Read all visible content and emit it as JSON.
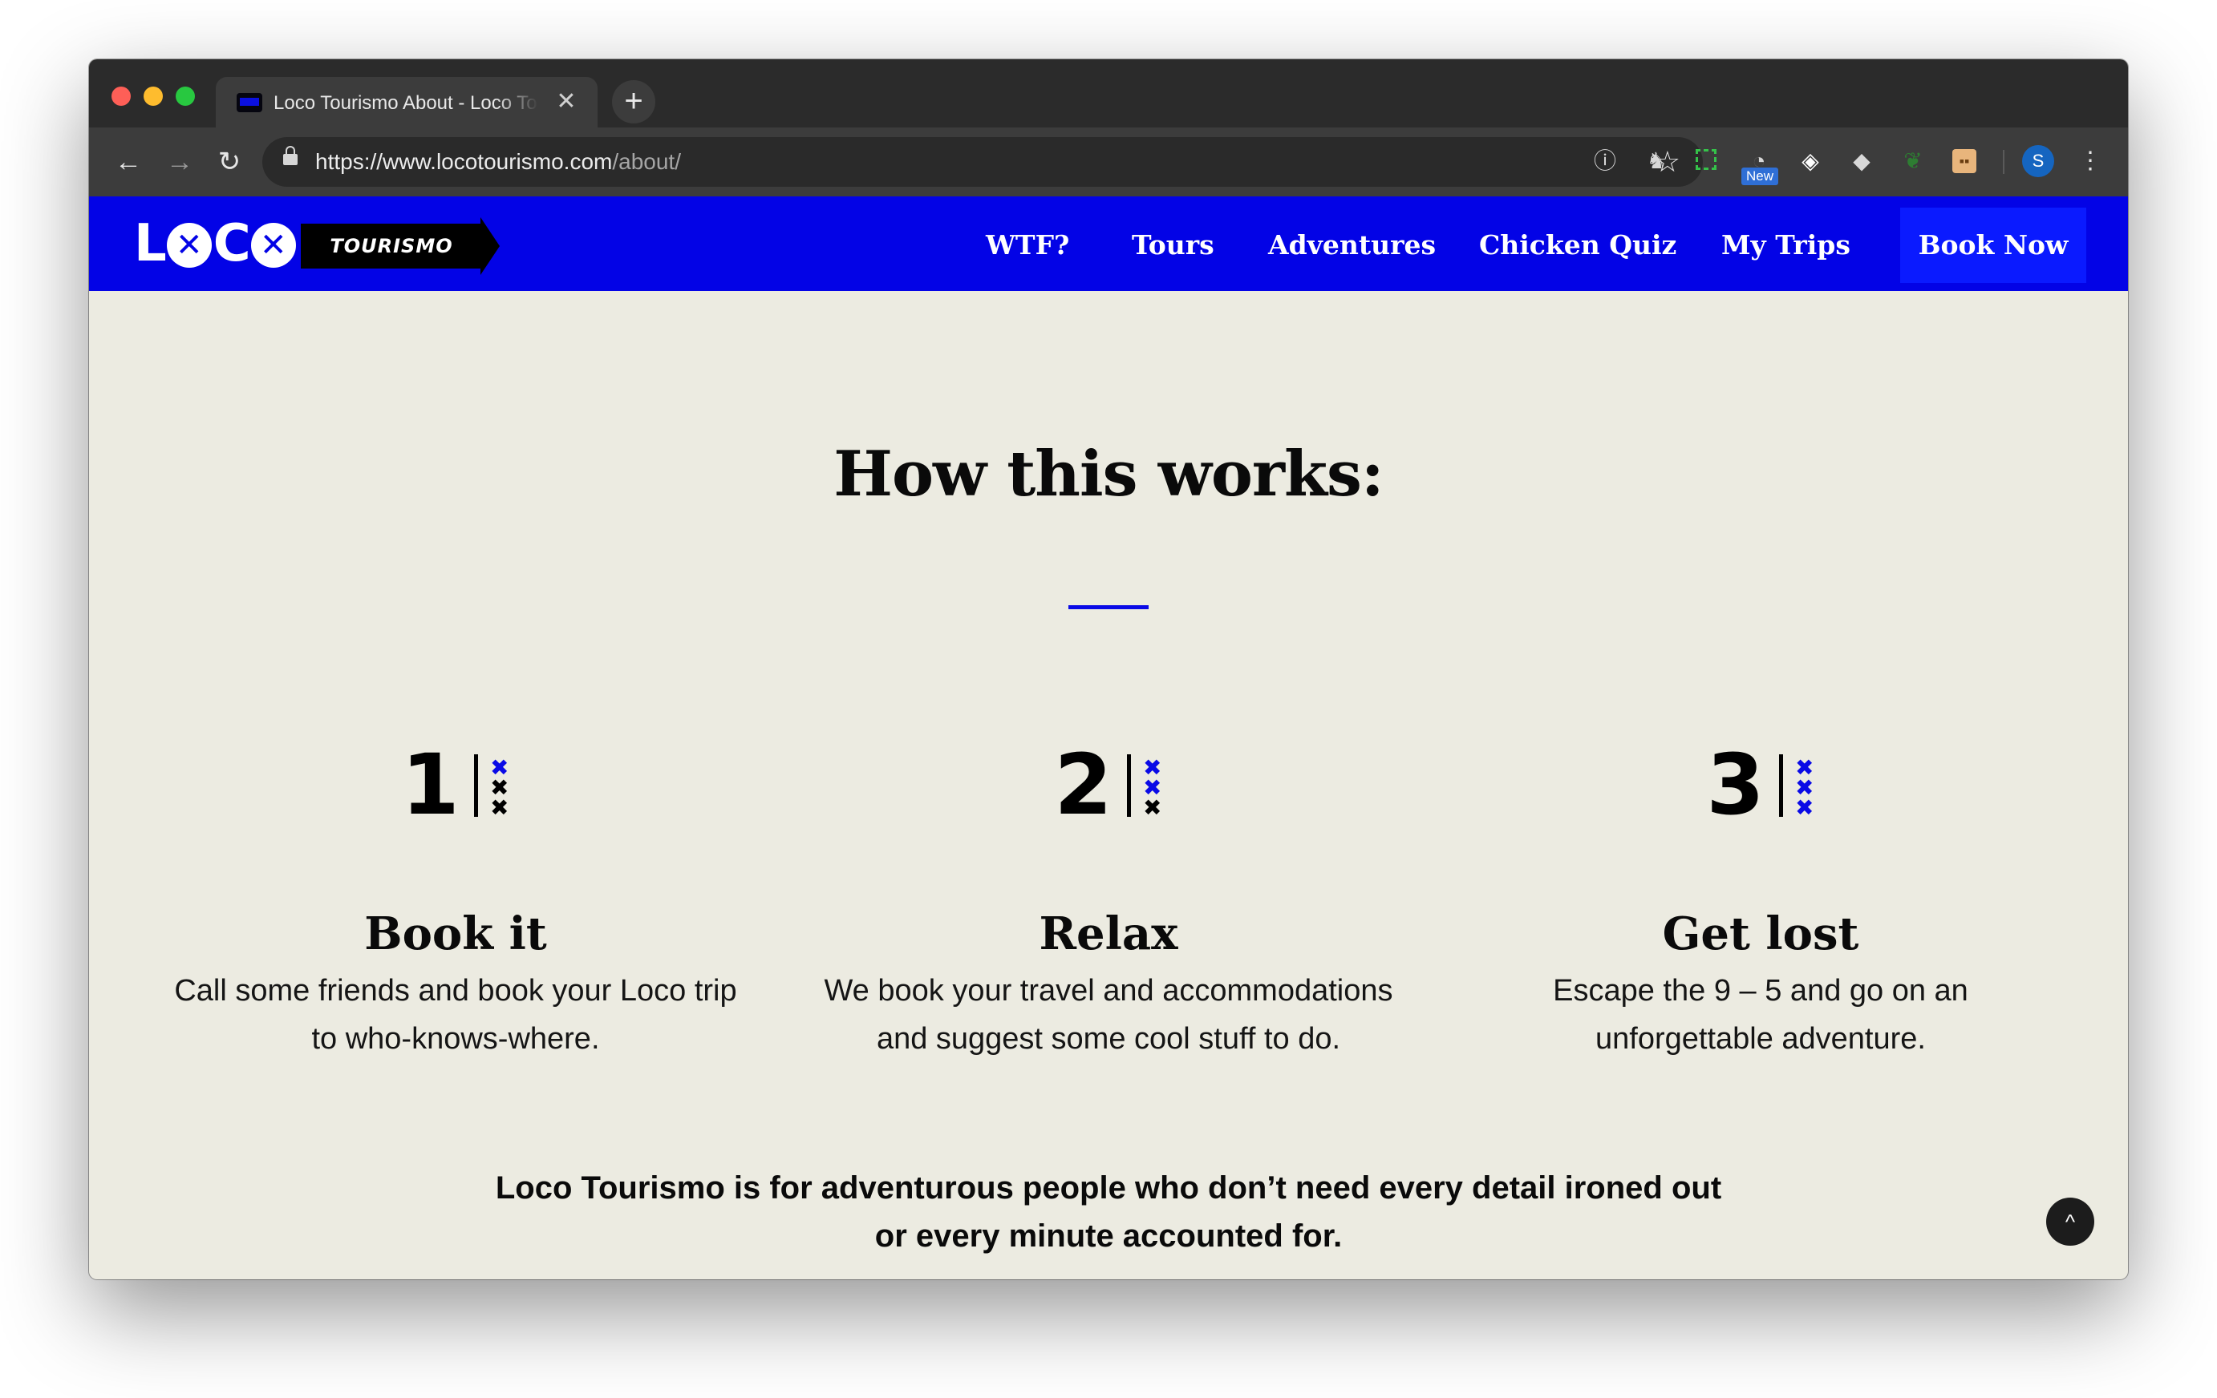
{
  "browser": {
    "tab_title": "Loco Tourismo About - Loco Tourismo",
    "tab_close": "✕",
    "new_tab": "+",
    "url_main": "https://www.locotourismo.com",
    "url_path": "/about/",
    "extension_badge": "New",
    "profile_initial": "S",
    "icons": {
      "back": "←",
      "forward": "→",
      "reload": "↻",
      "star": "☆",
      "info": "ⓘ",
      "menu": "⋮",
      "gem": "◈",
      "tag": "◆",
      "leaf": "❦",
      "puzzle": "♞",
      "gauge": "◔",
      "face": "▪▪"
    }
  },
  "site": {
    "logo_word": "L",
    "logo_x": "✕",
    "logo_c": "C",
    "logo_banner": "TOURISMO",
    "nav": [
      "WTF?",
      "Tours",
      "Adventures",
      "Chicken Quiz",
      "My Trips"
    ],
    "cta": "Book Now",
    "accent_color": "#0303e6",
    "background_color": "#ecebe1"
  },
  "main": {
    "title": "How this works:",
    "steps": [
      {
        "number": "1",
        "title": "Book it",
        "desc_1": "Call some friends and book your Loco trip",
        "desc_2": "to who-knows-where."
      },
      {
        "number": "2",
        "title": "Relax",
        "desc_1": "We book your travel and accommodations",
        "desc_2": "and suggest some cool stuff to do."
      },
      {
        "number": "3",
        "title": "Get lost",
        "desc_1": "Escape the 9 – 5 and go on an",
        "desc_2": "unforgettable adventure."
      }
    ],
    "x_mark": "✖",
    "tagline_1": "Loco Tourismo is for adventurous people who don’t need every detail ironed out",
    "tagline_2": "or every minute accounted for.",
    "back_to_top": "^"
  }
}
